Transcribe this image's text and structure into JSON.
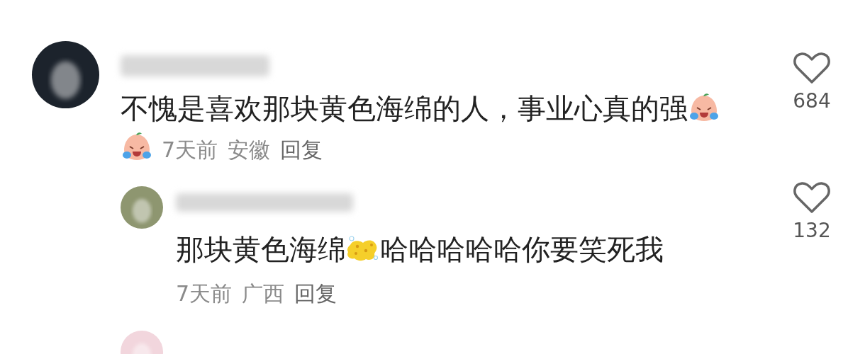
{
  "comments": [
    {
      "kind": "top",
      "avatar": {
        "color": "#1c232c"
      },
      "content": [
        {
          "kind": "text",
          "text": "不愧是喜欢那块黄色海绵的人，事业心真的强"
        },
        {
          "kind": "crying-emoji"
        },
        {
          "kind": "crying-emoji"
        }
      ],
      "time": "7天前",
      "location": "安徽",
      "reply": "回复",
      "likes": "684",
      "liked": false
    },
    {
      "kind": "reply",
      "avatar": {
        "color": "#8e9670"
      },
      "content": [
        {
          "kind": "text",
          "text": "那块黄色海绵"
        },
        {
          "kind": "sponge-emoji"
        },
        {
          "kind": "text",
          "text": "哈哈哈哈哈你要笑死我"
        }
      ],
      "time": "7天前",
      "location": "广西",
      "reply": "回复",
      "likes": "132",
      "liked": false
    },
    {
      "kind": "avatar-only",
      "avatar": {
        "color": "#f2d6dd"
      }
    }
  ]
}
